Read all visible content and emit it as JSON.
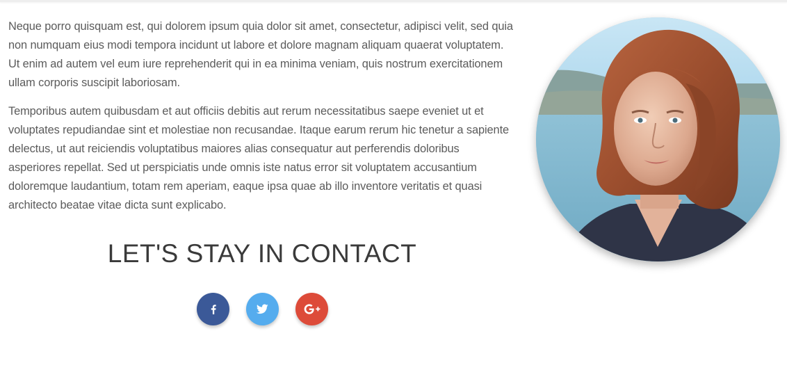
{
  "about": {
    "paragraphs": [
      "Neque porro quisquam est, qui dolorem ipsum quia dolor sit amet, consectetur, adipisci velit, sed quia non numquam eius modi tempora incidunt ut labore et dolore magnam aliquam quaerat voluptatem. Ut enim ad autem vel eum iure reprehenderit qui in ea minima veniam, quis nostrum exercitationem ullam corporis suscipit laboriosam.",
      "Temporibus autem quibusdam et aut officiis debitis aut rerum necessitatibus saepe eveniet ut et voluptates repudiandae sint et molestiae non recusandae. Itaque earum rerum hic tenetur a sapiente delectus, ut aut reiciendis voluptatibus maiores alias consequatur aut perferendis doloribus asperiores repellat. Sed ut perspiciatis unde omnis iste natus error sit voluptatem accusantium doloremque laudantium, totam rem aperiam, eaque ipsa quae ab illo inventore veritatis et quasi architecto beatae vitae dicta sunt explicabo."
    ]
  },
  "contact": {
    "heading": "LET'S STAY IN CONTACT",
    "social": [
      {
        "name": "facebook",
        "icon": "facebook-icon",
        "glyph": "f",
        "color": "#3b5998"
      },
      {
        "name": "twitter",
        "icon": "twitter-icon",
        "glyph": "bird",
        "color": "#55acee"
      },
      {
        "name": "google-plus",
        "icon": "google-plus-icon",
        "glyph": "G+",
        "color": "#dd4b39"
      }
    ]
  },
  "profile": {
    "photo": "woman-portrait-photo"
  }
}
